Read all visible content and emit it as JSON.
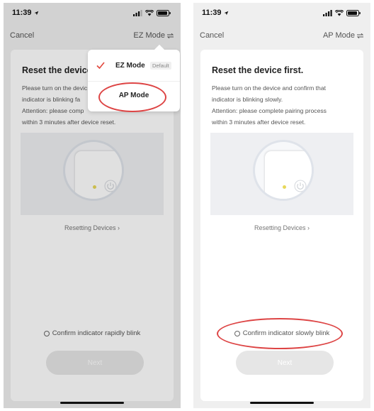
{
  "status": {
    "time": "11:39"
  },
  "left": {
    "nav": {
      "cancel": "Cancel",
      "mode": "EZ Mode"
    },
    "card": {
      "title": "Reset the device",
      "desc_lines": [
        "Please turn on the devic",
        "indicator is blinking fa",
        "Attention: please comp",
        "within 3 minutes after device reset."
      ],
      "reset_link": "Resetting Devices ›",
      "confirm_label": "Confirm indicator rapidly blink",
      "next_label": "Next"
    },
    "popup": {
      "item1_label": "EZ Mode",
      "item1_badge": "Default",
      "item2_label": "AP Mode"
    }
  },
  "right": {
    "nav": {
      "cancel": "Cancel",
      "mode": "AP Mode"
    },
    "card": {
      "title": "Reset the device first.",
      "desc_lines": [
        "Please turn on the device and confirm that",
        "indicator is blinking slowly.",
        "Attention: please complete pairing process",
        "within 3 minutes after device reset."
      ],
      "reset_link": "Resetting Devices ›",
      "confirm_label": "Confirm indicator slowly blink",
      "next_label": "Next"
    }
  },
  "colors": {
    "accent": "#e2463c",
    "annotation": "#dd4444",
    "led": "#e8d85a"
  },
  "icons": [
    "signal-icon",
    "wifi-icon",
    "battery-icon",
    "location-arrow-icon",
    "swap-icon",
    "check-icon",
    "power-icon"
  ]
}
